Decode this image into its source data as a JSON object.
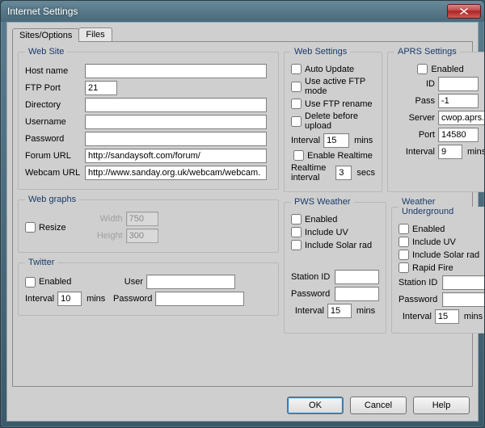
{
  "window": {
    "title": "Internet Settings"
  },
  "tabs": {
    "sites_options": "Sites/Options",
    "files": "Files"
  },
  "website": {
    "legend": "Web Site",
    "host_label": "Host name",
    "host": "",
    "ftp_port_label": "FTP Port",
    "ftp_port": "21",
    "directory_label": "Directory",
    "directory": "",
    "username_label": "Username",
    "username": "",
    "password_label": "Password",
    "password": "",
    "forum_label": "Forum URL",
    "forum": "http://sandaysoft.com/forum/",
    "webcam_label": "Webcam URL",
    "webcam": "http://www.sanday.org.uk/webcam/webcam."
  },
  "webgraphs": {
    "legend": "Web graphs",
    "resize_label": "Resize",
    "width_label": "Width",
    "width": "750",
    "height_label": "Height",
    "height": "300"
  },
  "twitter": {
    "legend": "Twitter",
    "enabled_label": "Enabled",
    "user_label": "User",
    "user": "",
    "interval_label": "Interval",
    "interval": "10",
    "mins": "mins",
    "password_label": "Password",
    "password": ""
  },
  "websettings": {
    "legend": "Web Settings",
    "auto_update": "Auto Update",
    "active_ftp": "Use active FTP mode",
    "ftp_rename": "Use FTP rename",
    "delete_before": "Delete before upload",
    "interval_label": "Interval",
    "interval": "15",
    "mins": "mins",
    "enable_realtime": "Enable Realtime",
    "realtime_label": "Realtime interval",
    "realtime": "3",
    "secs": "secs"
  },
  "aprs": {
    "legend": "APRS Settings",
    "enabled_label": "Enabled",
    "id_label": "ID",
    "id": "",
    "pass_label": "Pass",
    "pass": "-1",
    "server_label": "Server",
    "server": "cwop.aprs.net",
    "port_label": "Port",
    "port": "14580",
    "interval_label": "Interval",
    "interval": "9",
    "mins": "mins"
  },
  "pws": {
    "legend": "PWS Weather",
    "enabled_label": "Enabled",
    "uv_label": "Include UV",
    "solar_label": "Include Solar rad",
    "station_label": "Station ID",
    "station": "",
    "password_label": "Password",
    "password": "",
    "interval_label": "Interval",
    "interval": "15",
    "mins": "mins"
  },
  "wu": {
    "legend": "Weather Underground",
    "enabled_label": "Enabled",
    "uv_label": "Include UV",
    "solar_label": "Include Solar rad",
    "rapid_label": "Rapid Fire",
    "station_label": "Station ID",
    "station": "",
    "password_label": "Password",
    "password": "",
    "interval_label": "Interval",
    "interval": "15",
    "mins": "mins"
  },
  "buttons": {
    "ok": "OK",
    "cancel": "Cancel",
    "help": "Help"
  }
}
